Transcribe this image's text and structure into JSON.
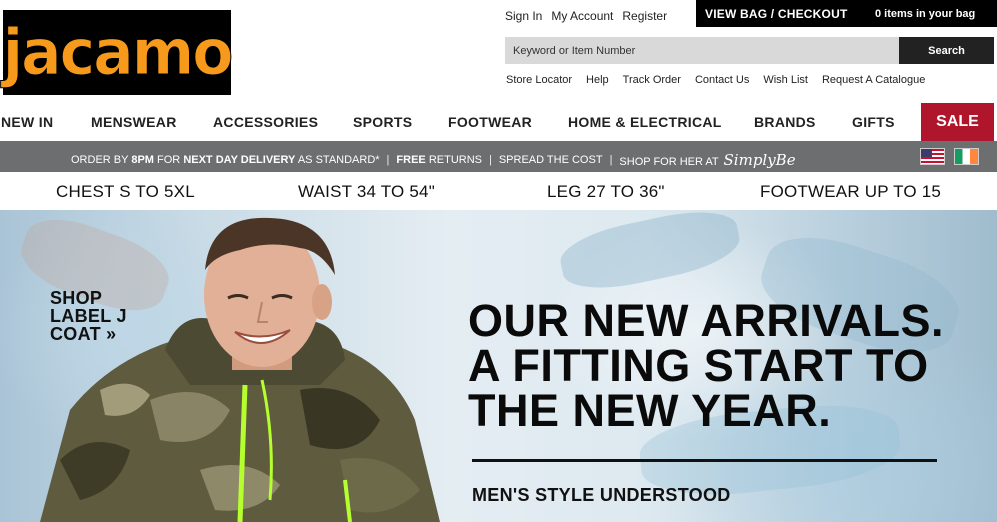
{
  "brand": {
    "logo_text": "jacamo"
  },
  "account": {
    "sign_in": "Sign In",
    "my_account": "My Account",
    "register": "Register"
  },
  "bag": {
    "checkout": "VIEW BAG / CHECKOUT",
    "count": "0 items in your bag"
  },
  "search": {
    "placeholder": "Keyword or Item Number",
    "button": "Search"
  },
  "utility_links": [
    "Store Locator",
    "Help",
    "Track Order",
    "Contact Us",
    "Wish List",
    "Request A Catalogue"
  ],
  "nav": {
    "items": [
      "NEW IN",
      "MENSWEAR",
      "ACCESSORIES",
      "SPORTS",
      "FOOTWEAR",
      "HOME & ELECTRICAL",
      "BRANDS",
      "GIFTS"
    ],
    "sale": "SALE",
    "sale_color": "#b0162b"
  },
  "promo": {
    "order_by": "ORDER BY",
    "time": "8PM",
    "for": "FOR",
    "next_day": "NEXT DAY DELIVERY",
    "standard": "AS STANDARD*",
    "free": "FREE",
    "returns": "RETURNS",
    "spread": "SPREAD THE COST",
    "shop_her": "SHOP FOR HER AT",
    "simplybe": "SimplyBe",
    "separator": "|",
    "flags": [
      "us-flag-icon",
      "ireland-flag-icon"
    ],
    "background": "#6d6e70"
  },
  "sizes": [
    {
      "label": "CHEST",
      "value": "S TO 5XL"
    },
    {
      "label": "WAIST",
      "value": "34 TO 54\""
    },
    {
      "label": "LEG",
      "value": "27 TO 36\""
    },
    {
      "label": "FOOTWEAR",
      "value": "UP TO 15"
    }
  ],
  "hero": {
    "shop_link": [
      "SHOP",
      "LABEL J",
      "COAT »"
    ],
    "headline": [
      "OUR NEW ARRIVALS.",
      "A FITTING START TO",
      "THE NEW YEAR."
    ],
    "subline": "MEN'S STYLE UNDERSTOOD"
  },
  "colors": {
    "logo_orange": "#f79a1b",
    "accent_black": "#000000"
  }
}
